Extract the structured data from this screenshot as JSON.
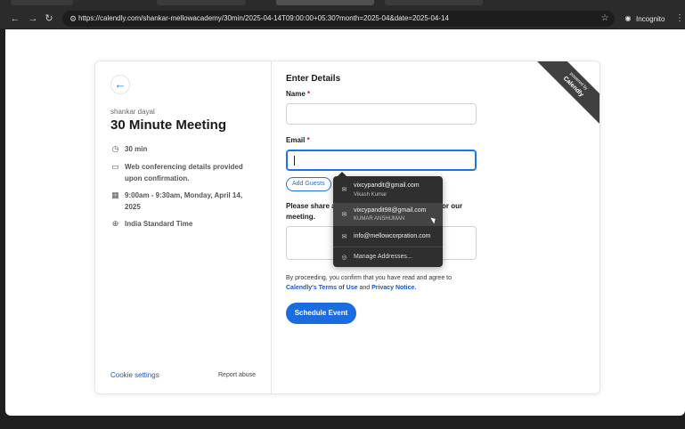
{
  "browser": {
    "url": "https://calendly.com/shankar-mellowacademy/30min/2025-04-14T09:00:00+05:30?month=2025-04&date=2025-04-14",
    "incognito_label": "Incognito"
  },
  "event": {
    "host_name": "shankar dayal",
    "title": "30 Minute Meeting",
    "duration": "30 min",
    "conferencing": "Web conferencing details provided upon confirmation.",
    "datetime": "9:00am - 9:30am, Monday, April 14, 2025",
    "timezone": "India Standard Time",
    "cookie_settings": "Cookie settings",
    "report_abuse": "Report abuse"
  },
  "form": {
    "heading": "Enter Details",
    "name_label": "Name",
    "email_label": "Email",
    "required_mark": "*",
    "add_guests": "Add Guests",
    "share_prefix": "Please share a",
    "share_suffix": "or our",
    "share_line2": "meeting.",
    "consent_text": "By proceeding, you confirm that you have read and agree to",
    "terms_link": "Calendly's Terms of Use",
    "and_text": "and",
    "privacy_link": "Privacy Notice.",
    "schedule_button": "Schedule Event"
  },
  "ribbon": {
    "line1": "powered by",
    "line2": "Calendly"
  },
  "autofill": {
    "items": [
      {
        "email": "vixcypandit@gmail.com",
        "name": "Vikash Kumar"
      },
      {
        "email": "vixcypandit98@gmail.com",
        "name": "KUMAR ANSHUMAN"
      },
      {
        "email": "info@mellowcorpration.com",
        "name": ""
      }
    ],
    "manage_label": "Manage Addresses..."
  },
  "colors": {
    "accent": "#1a6ce0",
    "link": "#1a56c7",
    "ribbon": "#404040",
    "dropdown_bg": "#2f2f2f"
  }
}
